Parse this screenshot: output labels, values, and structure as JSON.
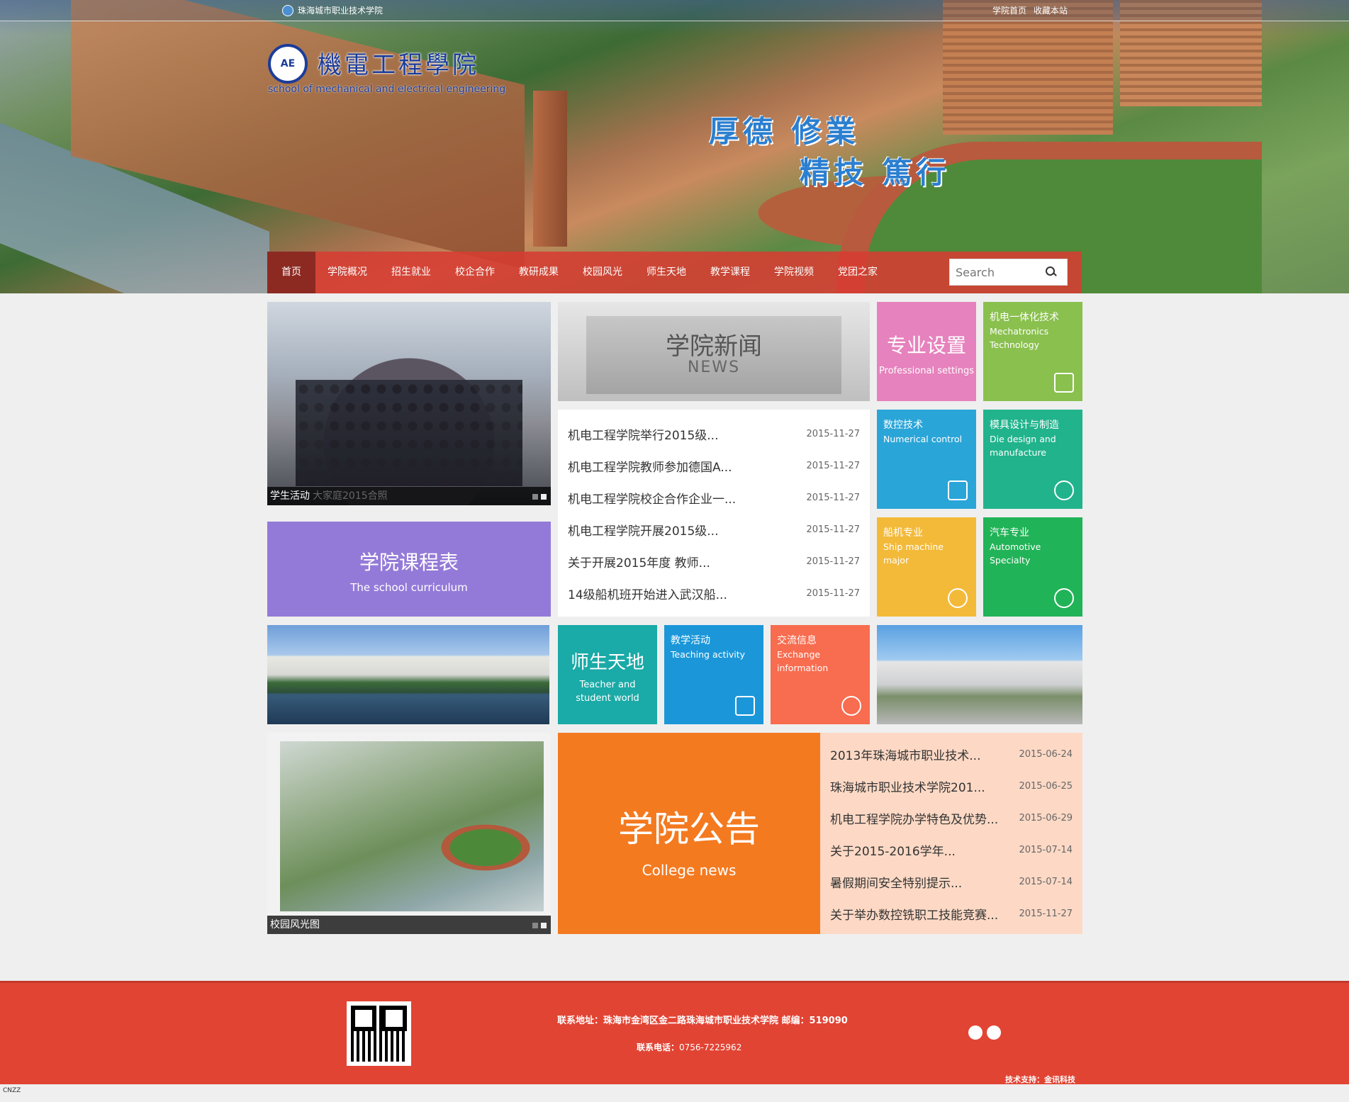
{
  "header": {
    "site_name": "珠海城市职业技术学院",
    "top_links": [
      "学院首页",
      "收藏本站"
    ],
    "logo_cn": "機電工程學院",
    "logo_en": "school of mechanical and electrical engineering",
    "logo_mark": "AE",
    "slogan_line1": "厚德 修業",
    "slogan_line2": "精技 篤行"
  },
  "nav": {
    "items": [
      "首页",
      "学院概况",
      "招生就业",
      "校企合作",
      "教研成果",
      "校园风光",
      "师生天地",
      "教学课程",
      "学院视频",
      "党团之家"
    ],
    "search_placeholder": "Search"
  },
  "student_activity": {
    "caption": "学生活动",
    "caption_sub": "大家庭2015合照"
  },
  "news": {
    "title_cn": "学院新闻",
    "title_en": "NEWS",
    "items": [
      {
        "title": "机电工程学院举行2015级...",
        "date": "2015-11-27"
      },
      {
        "title": "机电工程学院教师参加德国A...",
        "date": "2015-11-27"
      },
      {
        "title": "机电工程学院校企合作企业一...",
        "date": "2015-11-27"
      },
      {
        "title": "机电工程学院开展2015级...",
        "date": "2015-11-27"
      },
      {
        "title": "关于开展2015年度 教师...",
        "date": "2015-11-27"
      },
      {
        "title": "14级船机班开始进入武汉船...",
        "date": "2015-11-27"
      }
    ]
  },
  "tiles": {
    "major": {
      "cn": "专业设置",
      "en": "Professional settings"
    },
    "mech": {
      "cn": "机电一体化技术",
      "en": "Mechatronics Technology"
    },
    "nc": {
      "cn": "数控技术",
      "en": "Numerical control"
    },
    "die": {
      "cn": "模具设计与制造",
      "en": "Die design and manufacture"
    },
    "ship": {
      "cn": "船机专业",
      "en": "Ship machine major"
    },
    "auto": {
      "cn": "汽车专业",
      "en": "Automotive Specialty"
    },
    "schedule": {
      "cn": "学院课程表",
      "en": "The school curriculum"
    },
    "teacher": {
      "cn": "师生天地",
      "en": "Teacher and student world"
    },
    "teaching": {
      "cn": "教学活动",
      "en": "Teaching activity"
    },
    "exchange": {
      "cn": "交流信息",
      "en": "Exchange information"
    }
  },
  "campus_photo": {
    "caption": "校园风光图"
  },
  "notice": {
    "title_cn": "学院公告",
    "title_en": "College news",
    "items": [
      {
        "title": "2013年珠海城市职业技术...",
        "date": "2015-06-24"
      },
      {
        "title": "珠海城市职业技术学院201...",
        "date": "2015-06-25"
      },
      {
        "title": "机电工程学院办学特色及优势...",
        "date": "2015-06-29"
      },
      {
        "title": "关于2015-2016学年...",
        "date": "2015-07-14"
      },
      {
        "title": "暑假期间安全特别提示...",
        "date": "2015-07-14"
      },
      {
        "title": "关于举办数控铣职工技能竞赛...",
        "date": "2015-11-27"
      }
    ]
  },
  "footer": {
    "address_label": "联系地址：",
    "address": "珠海市金湾区金二路珠海城市职业技术学院 邮编：519090",
    "tel_label": "联系电话：",
    "tel": "0756-7225962",
    "support_label": "技术支持：",
    "support": "金讯科技"
  },
  "colors": {
    "nav_bg": "#d63c32",
    "footer_bg": "#e24434",
    "major": "#e682bd",
    "mech": "#8ac04e",
    "nc": "#2aa5d8",
    "die": "#21b38c",
    "ship": "#f3ba3a",
    "auto": "#21b357",
    "schedule": "#947ad8",
    "teacher": "#1aaaa7",
    "teaching": "#1b97d9",
    "exchange": "#f86c4f",
    "notice": "#f47a20"
  }
}
